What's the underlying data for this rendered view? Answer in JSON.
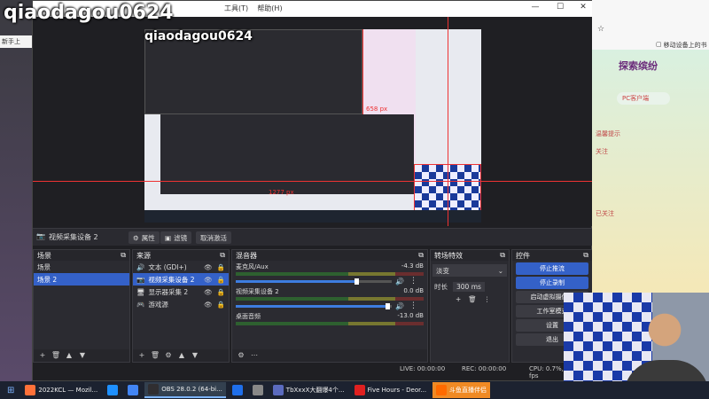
{
  "watermark": {
    "large": "qiaodagou0624",
    "small": "qiaodagou0624"
  },
  "left_browser": {
    "tab_label": "新手上"
  },
  "obs": {
    "menu": [
      "工具(T)",
      "帮助(H)"
    ],
    "window_buttons": [
      "—",
      "☐",
      "✕"
    ],
    "preview": {
      "size_label_1": "658 px",
      "size_label_2": "1277 px"
    },
    "source_bar": {
      "source_name": "视频采集设备 2",
      "properties": "属性",
      "filters": "滤镜",
      "deactivate": "取消激活"
    },
    "scenes": {
      "title": "场景",
      "items": [
        "场景",
        "场景 2"
      ],
      "selected": 1
    },
    "sources": {
      "title": "来源",
      "items": [
        {
          "icon": "speaker-icon",
          "label": "文本 (GDI+)"
        },
        {
          "icon": "camera-icon",
          "label": "视频采集设备 2"
        },
        {
          "icon": "monitor-icon",
          "label": "显示器采集 2"
        },
        {
          "icon": "gamepad-icon",
          "label": "游戏源"
        }
      ],
      "selected": 1
    },
    "mixer": {
      "title": "混音器",
      "channels": [
        {
          "name": "麦克风/Aux",
          "db": "-4.3 dB",
          "level": 0.78
        },
        {
          "name": "视频采集设备 2",
          "db": "0.0 dB",
          "level": 0.98
        },
        {
          "name": "桌面音频",
          "db": "-13.0 dB",
          "level": 0.6
        }
      ]
    },
    "transitions": {
      "title": "转场特效",
      "type": "淡变",
      "duration_label": "时长",
      "duration_value": "300 ms"
    },
    "controls": {
      "title": "控件",
      "buttons": [
        "停止推流",
        "停止录制",
        "启动虚拟摄像机",
        "工作室模式",
        "设置",
        "退出"
      ]
    },
    "status": {
      "live": "LIVE: 00:00:00",
      "rec": "REC: 00:00:00",
      "cpu": "CPU: 0.7%, 60.00 fps"
    }
  },
  "right_browser": {
    "pc_client": "PC客户端",
    "checkbox_label": "移动设备上的书签",
    "banner": "探索缤纷",
    "lines": [
      "温馨提示",
      "关注",
      "已关注"
    ]
  },
  "taskbar": {
    "apps": [
      {
        "label": "2022KCL — Mozil...",
        "color": "#ff7139",
        "active": false
      },
      {
        "label": "",
        "color": "#1e90ff",
        "active": false
      },
      {
        "label": "",
        "color": "#4285f4",
        "active": false
      },
      {
        "label": "OBS 28.0.2 (64-bi...",
        "color": "#302e31",
        "active": true
      },
      {
        "label": "",
        "color": "#1f6feb",
        "active": false
      },
      {
        "label": "",
        "color": "#888888",
        "active": false
      },
      {
        "label": "TbXxxX大翻爆4个...",
        "color": "#5b6bbf",
        "active": false
      },
      {
        "label": "Five Hours - Deor...",
        "color": "#e02020",
        "active": false
      },
      {
        "label": "斗鱼直播伴侣",
        "color": "#ff6a00",
        "active": false,
        "orange": true
      }
    ]
  }
}
